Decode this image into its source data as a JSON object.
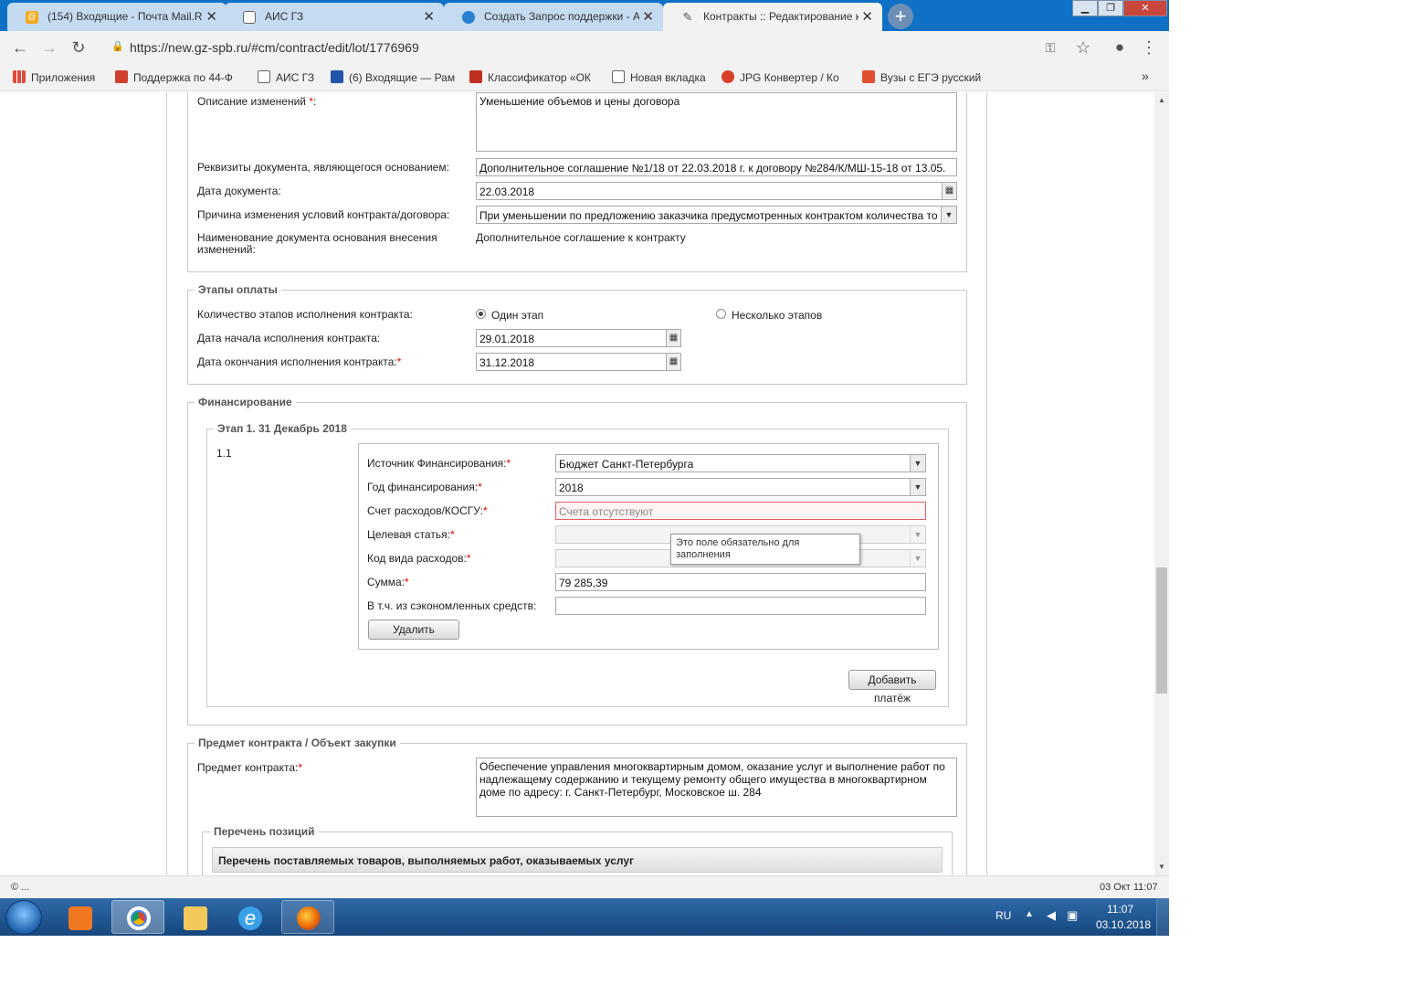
{
  "browser": {
    "tabs": [
      {
        "title": "(154) Входящие - Почта Mail.Ru",
        "close": "✕"
      },
      {
        "title": "АИС ГЗ",
        "close": "✕"
      },
      {
        "title": "Создать Запрос поддержки - АИ",
        "close": "✕"
      },
      {
        "title": "Контракты :: Редактирование к",
        "close": "✕"
      }
    ],
    "url": "https://new.gz-spb.ru/#cm/contract/edit/lot/1776969",
    "bookmarks": [
      "Приложения",
      "Поддержка по 44-Ф",
      "АИС ГЗ",
      "(6) Входящие — Рам",
      "Классификатор «ОК",
      "Новая вкладка",
      "JPG Конвертер / Ко",
      "Вузы с ЕГЭ русский"
    ],
    "bookmarks_more": "»"
  },
  "changes": {
    "description_label": "Описание изменений",
    "description_value": "Уменьшение объемов и цены договора",
    "doc_details_label": "Реквизиты документа, являющегося основанием:",
    "doc_details_value": "Дополнительное соглашение №1/18 от 22.03.2018 г. к договору №284/К/МШ-15-18 от 13.05.",
    "doc_date_label": "Дата документа:",
    "doc_date_value": "22.03.2018",
    "reason_label": "Причина изменения условий контракта/договора:",
    "reason_value": "При уменьшении по предложению заказчика предусмотренных контрактом количества то",
    "doc_name_label": "Наименование документа основания внесения изменений:",
    "doc_name_value": "Дополнительное соглашение к контракту"
  },
  "payment_stages": {
    "legend": "Этапы оплаты",
    "count_label": "Количество этапов исполнения контракта:",
    "option_one": "Один этап",
    "option_many": "Несколько этапов",
    "selected": "Один этап",
    "start_label": "Дата начала исполнения контракта:",
    "start_value": "29.01.2018",
    "end_label": "Дата окончания исполнения контракта:",
    "end_value": "31.12.2018"
  },
  "financing": {
    "legend": "Финансирование",
    "stage_legend": "Этап 1. 31 Декабрь 2018",
    "item_number": "1.1",
    "source_label": "Источник Финансирования:",
    "source_value": "Бюджет Санкт-Петербурга",
    "year_label": "Год финансирования:",
    "year_value": "2018",
    "account_label": "Счет расходов/КОСГУ:",
    "account_placeholder": "Счета отсутствуют",
    "target_label": "Целевая статья:",
    "expense_label": "Код вида расходов:",
    "sum_label": "Сумма:",
    "sum_value": "79 285,39",
    "savings_label": "В т.ч. из сэкономленных средств:",
    "delete_button": "Удалить",
    "add_payment_button": "Добавить платёж",
    "tooltip": "Это поле обязательно для заполнения"
  },
  "subject": {
    "legend": "Предмет контракта / Объект закупки",
    "label": "Предмет контракта:",
    "value": "Обеспечение управления многоквартирным домом, оказание услуг и выполнение работ по надлежащему содержанию и текущему ремонту общего имущества в многоквартирном доме по адресу: г. Санкт-Петербург, Московское ш. 284",
    "positions_legend": "Перечень позиций",
    "positions_header": "Перечень поставляемых товаров, выполняемых работ, оказываемых услуг"
  },
  "status_bar": {
    "left": "© ...",
    "right": "03 Окт 11:07"
  },
  "taskbar": {
    "lang": "RU",
    "time": "11:07",
    "date": "03.10.2018"
  },
  "colors": {
    "tabstrip": "#0f71c5",
    "required": "#dd0000",
    "error_border": "#e06060"
  }
}
